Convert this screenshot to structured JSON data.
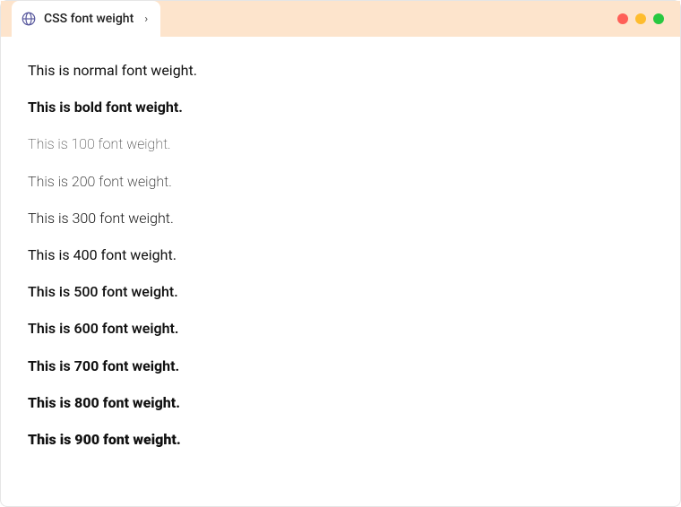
{
  "tab": {
    "title": "CSS font weight",
    "chevron": "›"
  },
  "lines": {
    "normal": "This is normal font weight.",
    "bold": "This is bold font weight.",
    "w100": "This is 100 font weight.",
    "w200": "This is 200 font weight.",
    "w300": "This is 300 font weight.",
    "w400": "This is 400 font weight.",
    "w500": "This is 500 font weight.",
    "w600": "This is 600 font weight.",
    "w700": "This is 700 font weight.",
    "w800": "This is 800 font weight.",
    "w900": "This is 900 font weight."
  }
}
